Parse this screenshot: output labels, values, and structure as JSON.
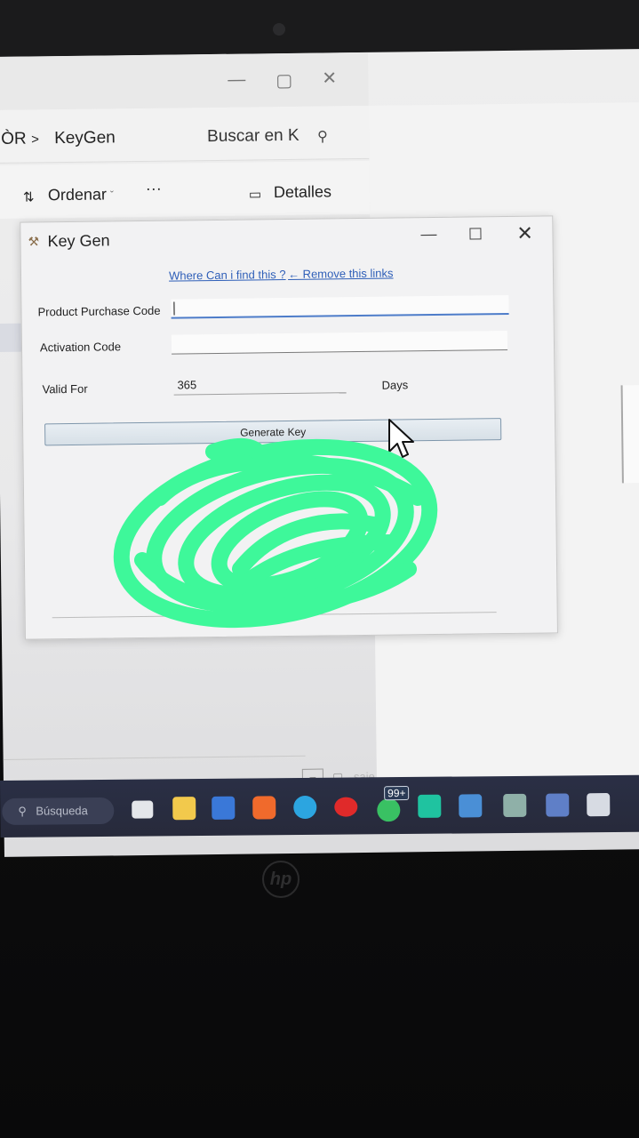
{
  "explorer": {
    "breadcrumb_prefix": "ÒR",
    "breadcrumb_separator": ">",
    "breadcrumb_folder": "KeyGen",
    "search_placeholder": "Buscar en K",
    "sort_label": "Ordenar",
    "more_label": "···",
    "details_label": "Detalles",
    "status_text": "saje"
  },
  "dialog": {
    "title": "Key Gen",
    "link_where": "Where Can i find this ?",
    "link_remove": "← Remove this links",
    "product_label": "Product Purchase Code",
    "product_value": "",
    "activation_label": "Activation Code",
    "activation_value": "",
    "valid_label": "Valid For",
    "valid_value": "365",
    "days_label": "Days",
    "generate_label": "Generate Key"
  },
  "taskbar": {
    "search_label": "Búsqueda",
    "badge": "99+",
    "apps": [
      "task-view",
      "file-explorer",
      "store",
      "brave",
      "telegram",
      "youtube",
      "whatsapp",
      "app-s",
      "app-photos",
      "app-monitor",
      "app-notes",
      "keygen"
    ]
  },
  "colors": {
    "scribble": "#3ef89a",
    "link": "#2f5fb8",
    "taskbar": "#2a2f45"
  },
  "brand": "hp"
}
